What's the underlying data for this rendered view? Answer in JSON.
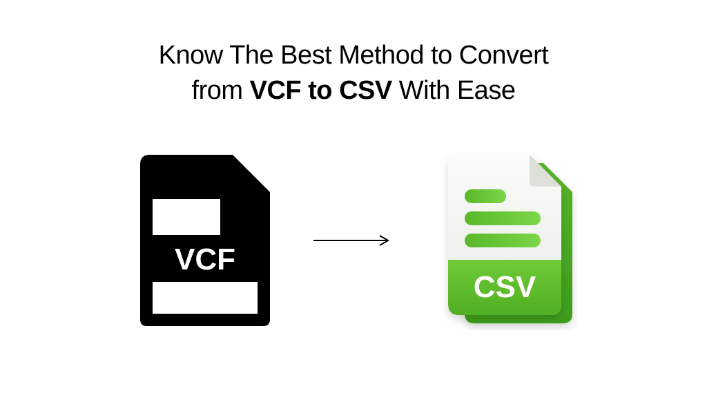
{
  "title": {
    "line1_prefix": "Know The Best Method to Convert",
    "line2_prefix": "from ",
    "bold": "VCF to CSV",
    "line2_suffix": " With Ease"
  },
  "icons": {
    "vcf_label": "VCF",
    "csv_label": "CSV"
  },
  "colors": {
    "vcf_black": "#000000",
    "csv_green": "#5DBB2C",
    "csv_green_dark": "#3E9C1B",
    "csv_body": "#F3F4F1"
  }
}
